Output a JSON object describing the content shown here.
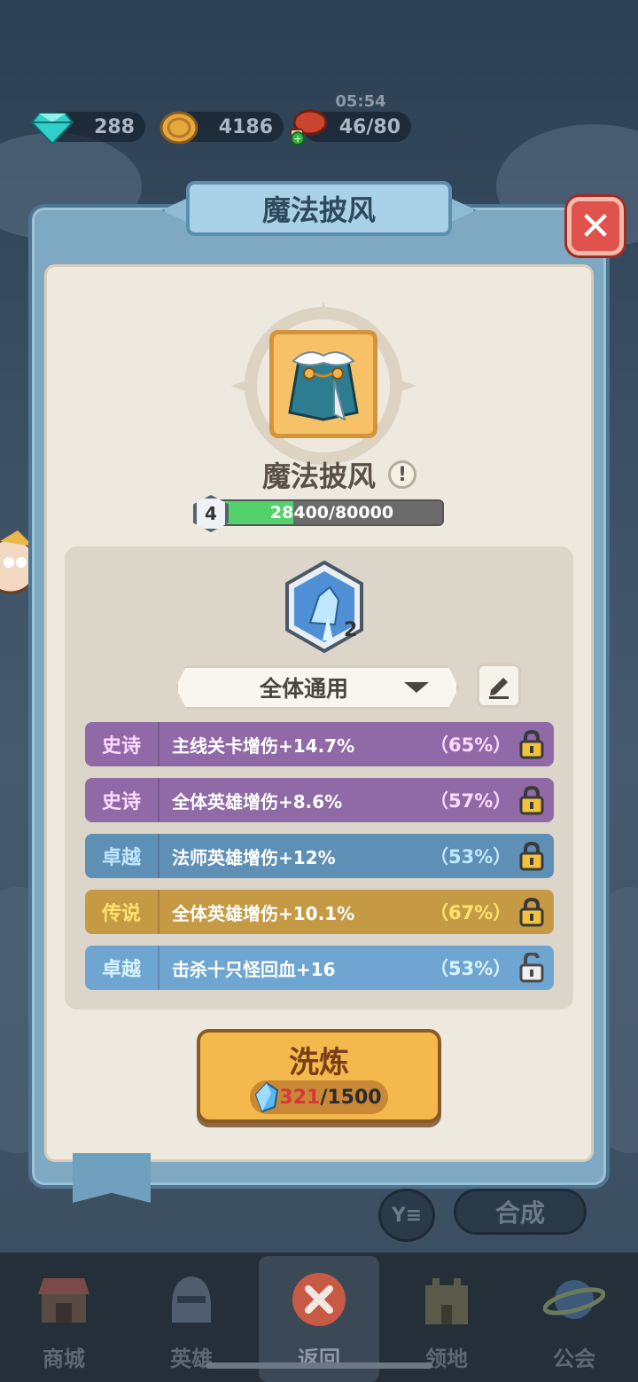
{
  "status": {
    "timer": "05:54"
  },
  "resources": [
    {
      "icon": "diamond-icon",
      "value": "288"
    },
    {
      "icon": "gold-coin-icon",
      "value": "4186"
    },
    {
      "icon": "meat-stamina-icon",
      "value": "46/80"
    }
  ],
  "dialog": {
    "title": "魔法披风",
    "close_icon": "close-icon"
  },
  "item": {
    "name": "魔法披风",
    "info_icon": "info-icon",
    "level": "4",
    "exp_text": "28400/80000",
    "exp_progress": 0.355
  },
  "rune": {
    "icon": "ice-rune-icon",
    "count": "2"
  },
  "dropdown": {
    "selected": "全体通用"
  },
  "stats": [
    {
      "rarity": "史诗",
      "text": "主线关卡增伤+14.7%",
      "pct": "（65%）",
      "locked": true,
      "color": "#8f6aa6",
      "rarity_color": "#ffd9ff"
    },
    {
      "rarity": "史诗",
      "text": "全体英雄增伤+8.6%",
      "pct": "（57%）",
      "locked": true,
      "color": "#8f6aa6",
      "rarity_color": "#ffd9ff"
    },
    {
      "rarity": "卓越",
      "text": "法师英雄增伤+12%",
      "pct": "（53%）",
      "locked": true,
      "color": "#5e8fb5",
      "rarity_color": "#bfe8ff"
    },
    {
      "rarity": "传说",
      "text": "全体英雄增伤+10.1%",
      "pct": "（67%）",
      "locked": true,
      "color": "#c69a45",
      "rarity_color": "#ffe36b"
    },
    {
      "rarity": "卓越",
      "text": "击杀十只怪回血+16",
      "pct": "（53%）",
      "locked": false,
      "color": "#6fa6d1",
      "rarity_color": "#d8f2ff"
    }
  ],
  "wash": {
    "label": "洗炼",
    "cost_have": "321",
    "cost_need": "/1500",
    "cost_have_color": "#d8373a"
  },
  "background_buttons": {
    "combine": "合成",
    "filter": "Y≡"
  },
  "nav": [
    {
      "label": "商城",
      "icon": "shop-icon"
    },
    {
      "label": "英雄",
      "icon": "helmet-icon"
    },
    {
      "label": "返回",
      "icon": "close-icon"
    },
    {
      "label": "领地",
      "icon": "castle-icon"
    },
    {
      "label": "公会",
      "icon": "planet-icon"
    }
  ]
}
